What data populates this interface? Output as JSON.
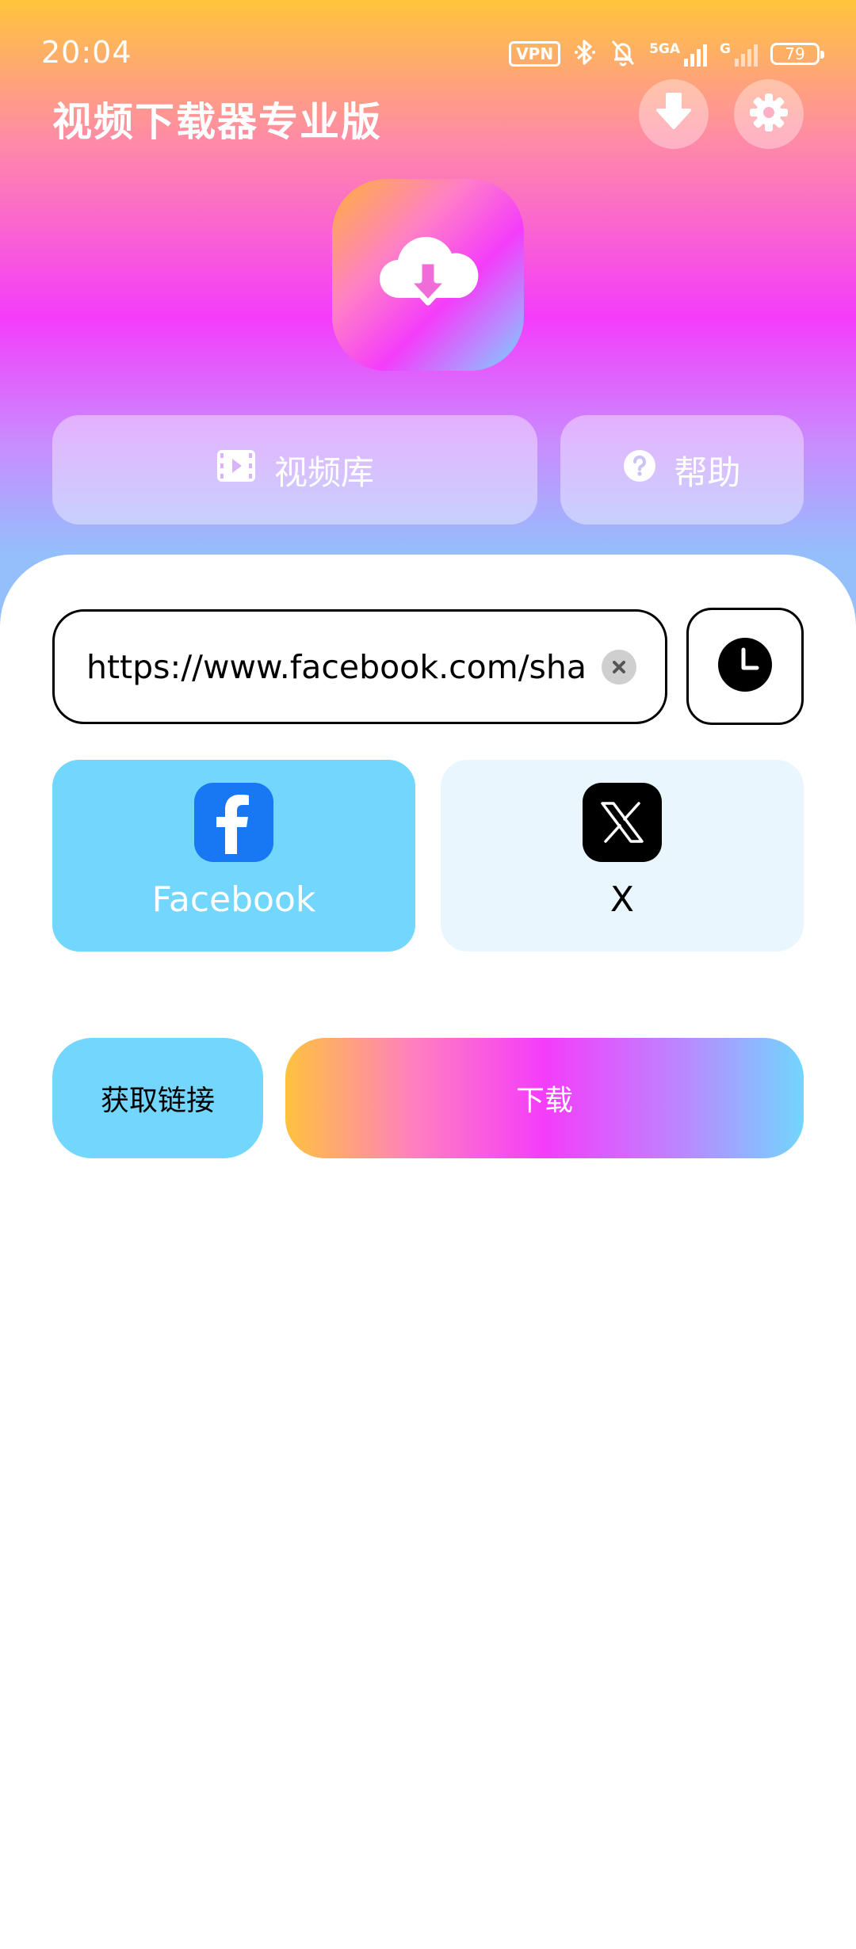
{
  "status_bar": {
    "time": "20:04",
    "vpn_label": "VPN",
    "network_label_1": "5GA",
    "network_label_2": "G",
    "battery_level": "79"
  },
  "header": {
    "title": "视频下载器专业版"
  },
  "nav": {
    "library_label": "视频库",
    "help_label": "帮助"
  },
  "url_input": {
    "value": "https://www.facebook.com/share"
  },
  "platforms": [
    {
      "label": "Facebook",
      "icon": "facebook-icon",
      "selected": true
    },
    {
      "label": "X",
      "icon": "x-icon",
      "selected": false
    }
  ],
  "actions": {
    "get_link_label": "获取链接",
    "download_label": "下载"
  },
  "colors": {
    "accent_blue": "#72d6fd",
    "facebook_blue": "#1877f2",
    "unselected_card": "#eaf6fd",
    "gradient_pink": "#f43cfb",
    "gradient_yellow": "#ffc23e"
  }
}
